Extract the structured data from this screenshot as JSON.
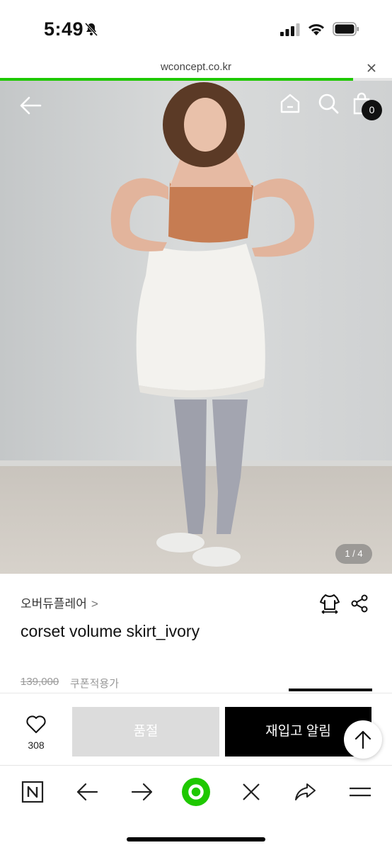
{
  "status_bar": {
    "time": "5:49",
    "icons": [
      "bell-slash-icon",
      "signal-icon",
      "wifi-icon",
      "battery-icon"
    ]
  },
  "browser": {
    "url": "wconcept.co.kr",
    "load_progress": 0.9
  },
  "header": {
    "cart_count": "0",
    "icons": [
      "back-arrow-icon",
      "home-icon",
      "search-icon",
      "shopping-bag-icon"
    ]
  },
  "gallery": {
    "pager": "1 / 4"
  },
  "product": {
    "brand": "오버듀플레어",
    "brand_chevron": ">",
    "name": "corset volume skirt_ivory",
    "original_price": "139,000",
    "coupon_label": "쿠폰적용가"
  },
  "actions": {
    "wish_count": "308",
    "soldout_label": "품절",
    "restock_label": "재입고 알림"
  },
  "colors": {
    "accent_green": "#1ec800",
    "primary_black": "#000000",
    "disabled_gray": "#dcdcdc"
  }
}
